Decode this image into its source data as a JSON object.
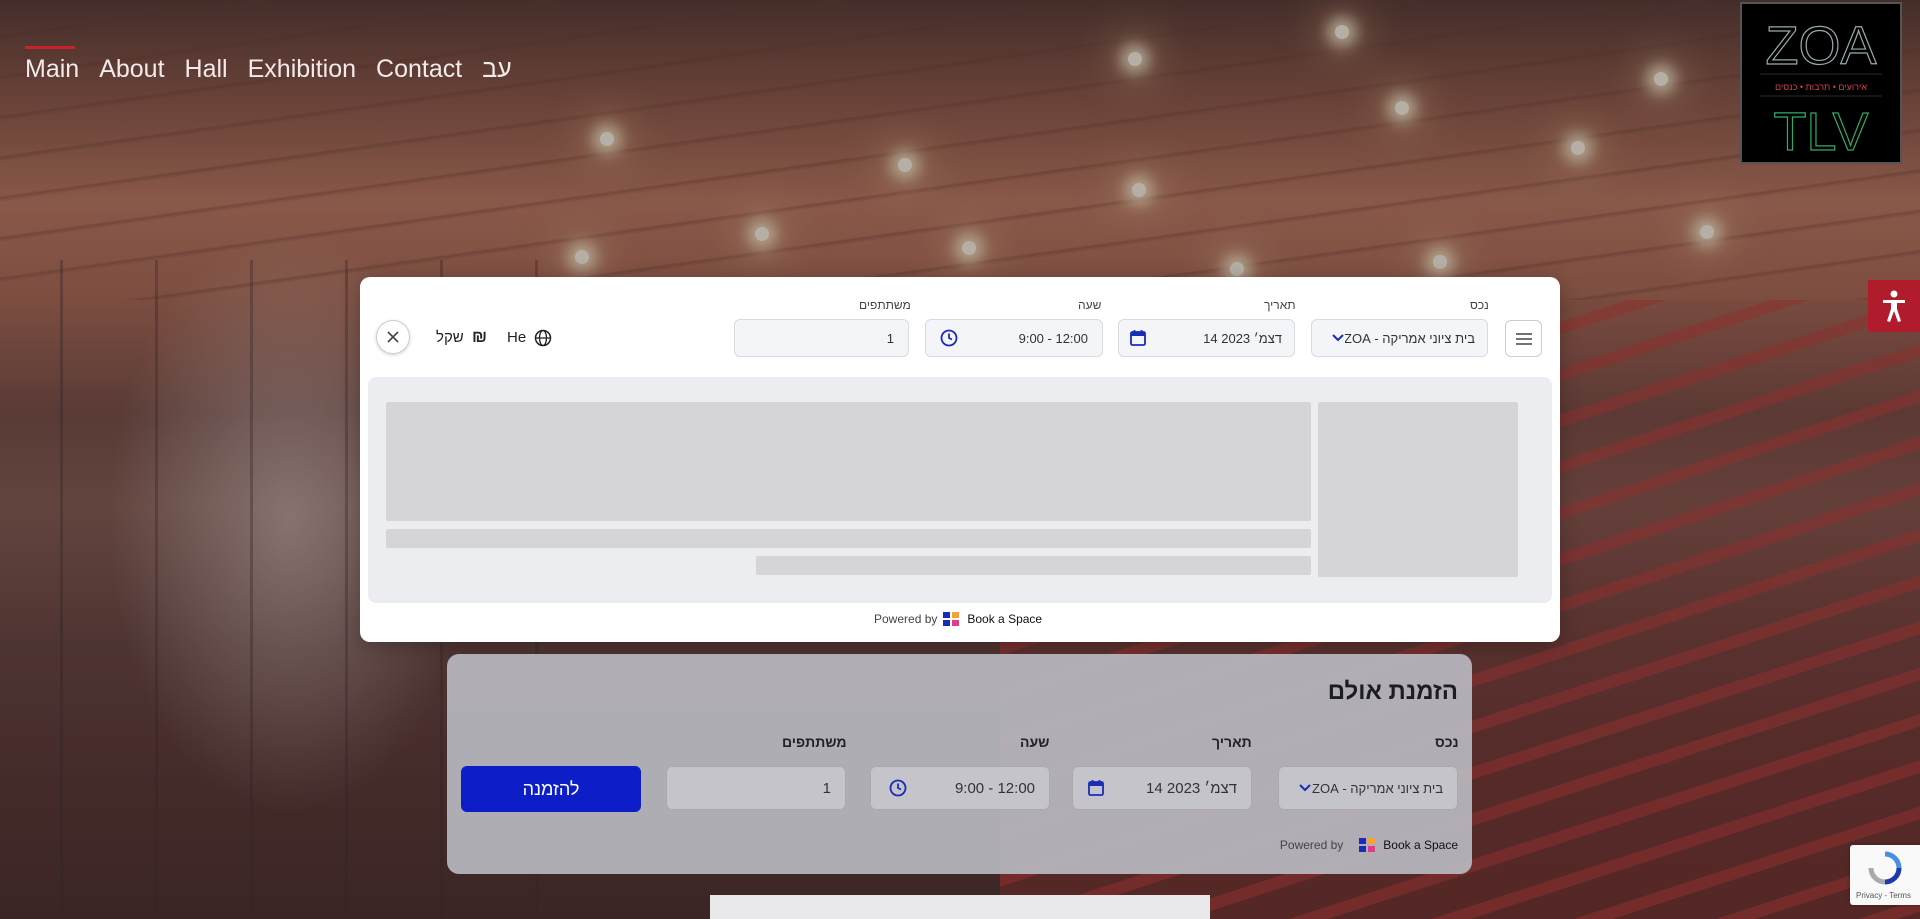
{
  "nav": {
    "items": [
      {
        "label": "Main",
        "active": true
      },
      {
        "label": "About",
        "active": false
      },
      {
        "label": "Hall",
        "active": false
      },
      {
        "label": "Exhibition",
        "active": false
      },
      {
        "label": "Contact",
        "active": false
      },
      {
        "label": "עב",
        "active": false
      }
    ]
  },
  "logo": {
    "top": "ZOA",
    "tagline": "אירועים • תרבות • כנסים",
    "bottom": "TLV"
  },
  "modal": {
    "close_icon": "close-icon",
    "currency_label": "שקל",
    "currency_symbol": "₪",
    "language_label": "He",
    "fields": {
      "property": {
        "label": "נכס",
        "value": "בית ציוני אמריקה - ZOA"
      },
      "date": {
        "label": "תאריך",
        "value": "14 דצמ׳ 2023"
      },
      "time": {
        "label": "שעה",
        "value": "9:00 - 12:00"
      },
      "participants": {
        "label": "משתתפים",
        "value": "1"
      }
    },
    "powered_by": "Powered by",
    "brand": "Book a Space"
  },
  "booking_card": {
    "title": "הזמנת אולם",
    "fields": {
      "property": {
        "label": "נכס",
        "value": "בית ציוני אמריקה - ZOA"
      },
      "date": {
        "label": "תאריך",
        "value": "14 דצמ׳ 2023"
      },
      "time": {
        "label": "שעה",
        "value": "9:00 - 12:00"
      },
      "participants": {
        "label": "משתתפים",
        "value": "1"
      }
    },
    "book_button": "להזמנה",
    "powered_by": "Powered by",
    "brand": "Book a Space"
  },
  "recaptcha": {
    "text": "Privacy - Terms"
  },
  "colors": {
    "accent": "#c8232c",
    "primary_button": "#0d1ec9",
    "icon_blue": "#1a2bb8"
  }
}
